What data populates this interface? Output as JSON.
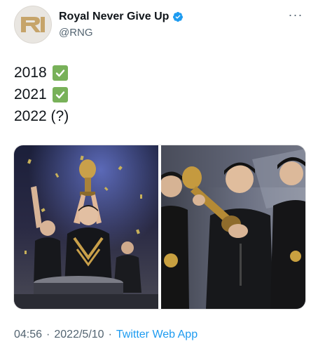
{
  "account": {
    "display_name": "Royal Never Give Up",
    "handle": "@RNG",
    "verified": true,
    "avatar_icon": "rng-logo",
    "avatar_logo_text": "RNG"
  },
  "more_icon": "more-horizontal-icon",
  "tweet": {
    "lines": [
      {
        "text": "2018",
        "emoji": "check-mark-button"
      },
      {
        "text": "2021",
        "emoji": "check-mark-button"
      },
      {
        "text": "2022 (?)",
        "emoji": null
      }
    ]
  },
  "media": {
    "photos": [
      {
        "name": "trophy-lift-photo-1"
      },
      {
        "name": "trophy-lift-photo-2"
      }
    ]
  },
  "meta": {
    "time": "04:56",
    "separator": "·",
    "date": "2022/5/10",
    "source": "Twitter Web App"
  },
  "colors": {
    "verified": "#1d9bf0",
    "link": "#1d9bf0",
    "secondary_text": "#536471",
    "check_emoji": "#78b159"
  }
}
